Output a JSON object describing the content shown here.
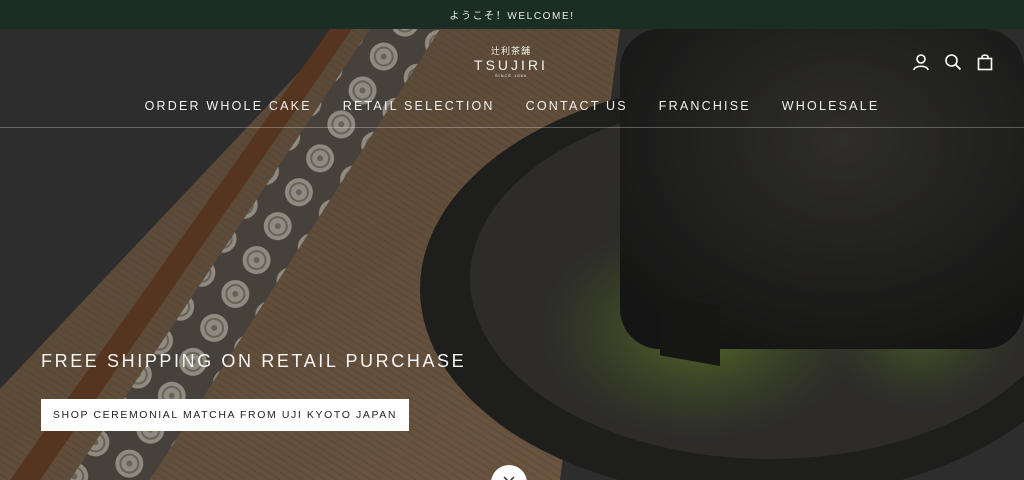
{
  "announcement": {
    "text": "ようこそ！WELCOME!"
  },
  "brand": {
    "kanji": "辻利茶舗",
    "name": "TSUJIRI",
    "since": "SINCE 1860"
  },
  "header_icons": [
    "account-icon",
    "search-icon",
    "shopping-bag-icon"
  ],
  "nav": {
    "items": [
      {
        "label": "ORDER WHOLE CAKE"
      },
      {
        "label": "RETAIL SELECTION"
      },
      {
        "label": "CONTACT US"
      },
      {
        "label": "FRANCHISE"
      },
      {
        "label": "WHOLESALE"
      }
    ]
  },
  "hero": {
    "heading": "FREE SHIPPING ON RETAIL PURCHASE",
    "cta_label": "SHOP CEREMONIAL MATCHA FROM UJI KYOTO JAPAN"
  },
  "colors": {
    "announcement_bg": "#1b2d24",
    "matcha": "#6b8a2f",
    "button_bg": "#ffffff"
  }
}
